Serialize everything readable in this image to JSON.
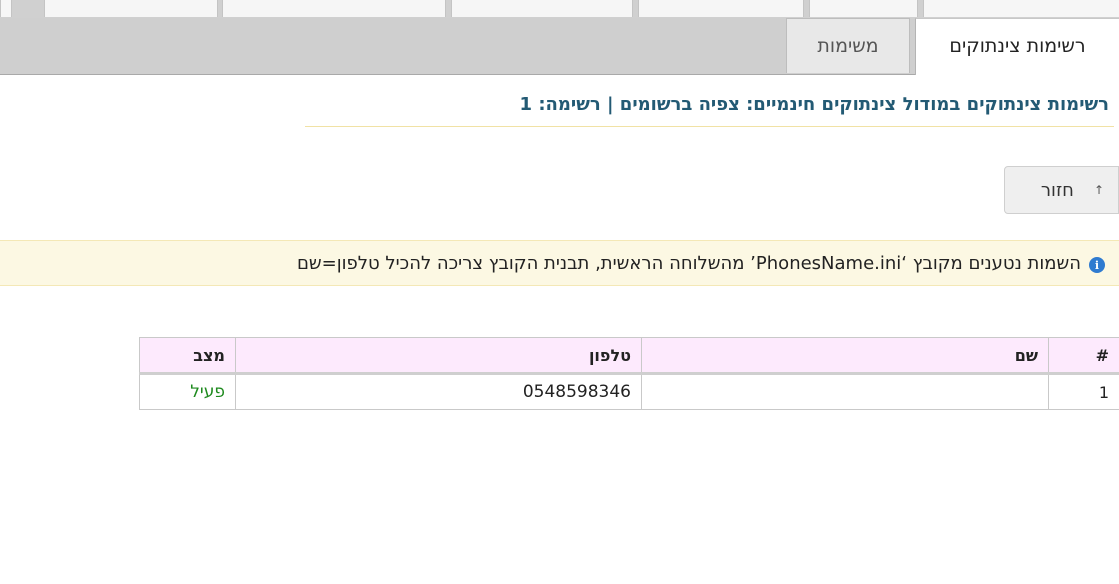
{
  "tabs": {
    "active_label": "רשימות צינתוקים",
    "inactive_label": "משימות"
  },
  "page": {
    "title": "רשימות צינתוקים במודול צינתוקים חינמיים: צפיה ברשומים | רשימה: 1",
    "back_label": "חזור",
    "back_icon": "up-arrow-icon"
  },
  "info": {
    "icon": "info-icon",
    "text": "השמות נטענים מקובץ ‘PhonesName.ini’ מהשלוחה הראשית, תבנית הקובץ צריכה להכיל טלפון=שם"
  },
  "table": {
    "headers": {
      "index": "#",
      "name": "שם",
      "phone": "טלפון",
      "status": "מצב"
    },
    "rows": [
      {
        "index": "1",
        "name": "",
        "phone": "0548598346",
        "status": "פעיל"
      }
    ]
  },
  "colors": {
    "title": "#235a74",
    "header_row": "#fdeafd",
    "banner": "#fcf8e3",
    "status_active": "#1e8a1e"
  }
}
